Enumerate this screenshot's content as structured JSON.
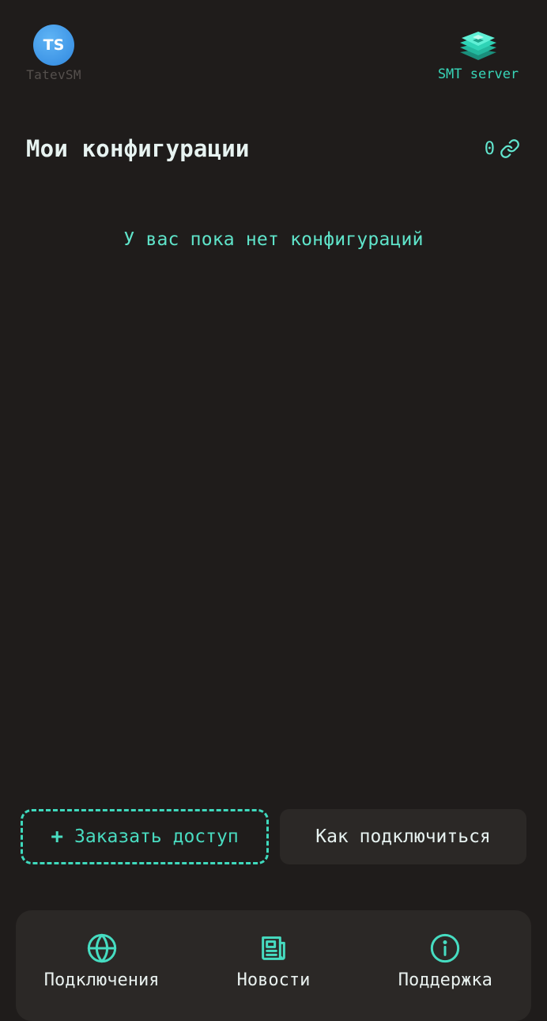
{
  "header": {
    "avatar_initials": "TS",
    "username": "TatevSM",
    "server_name": "SMT server",
    "server_icon": "server-stack-icon"
  },
  "configs": {
    "title": "Мои конфигурации",
    "count": "0",
    "count_icon": "link-icon",
    "empty_message": "У вас пока нет конфигураций"
  },
  "actions": {
    "order_icon": "+",
    "order_label": "Заказать доступ",
    "howto_label": "Как подключиться"
  },
  "nav": {
    "items": [
      {
        "label": "Подключения",
        "icon": "globe-icon"
      },
      {
        "label": "Новости",
        "icon": "newspaper-icon"
      },
      {
        "label": "Поддержка",
        "icon": "info-icon"
      }
    ]
  },
  "colors": {
    "background": "#1f1c1b",
    "accent": "#3fd9bd",
    "panel": "#2b2826",
    "avatar": "#3e95e6"
  }
}
